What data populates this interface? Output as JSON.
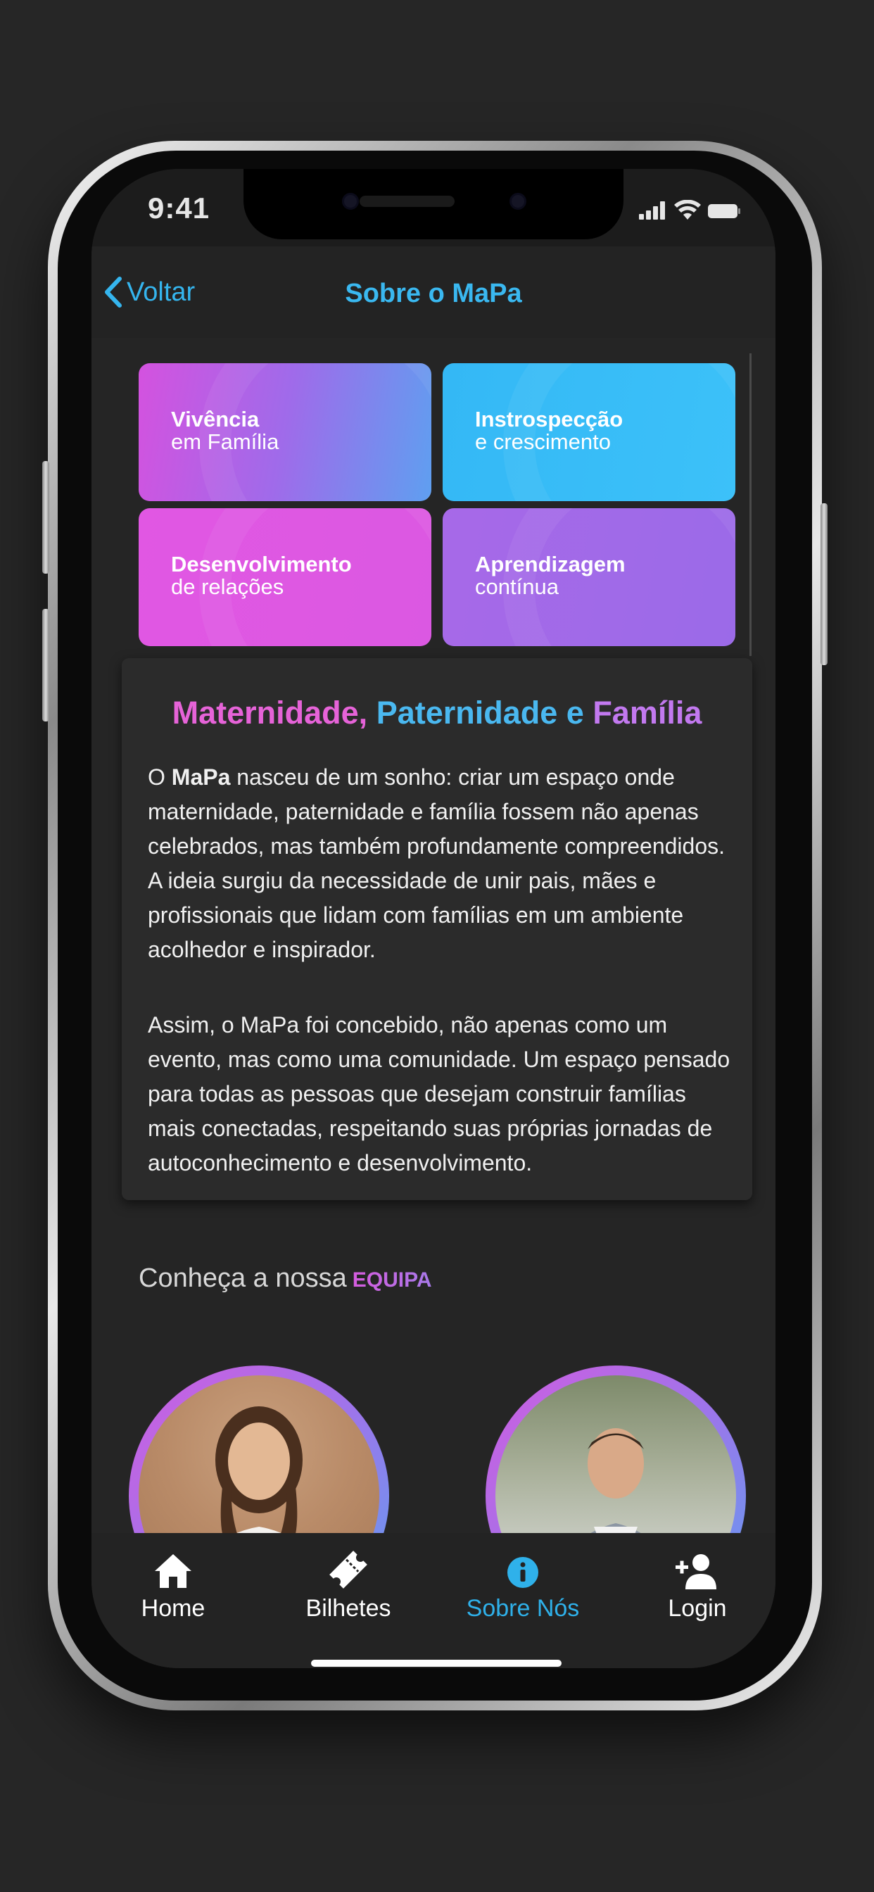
{
  "status_bar": {
    "time": "9:41"
  },
  "nav": {
    "back_label": "Voltar",
    "title": "Sobre o MaPa"
  },
  "tiles": [
    {
      "title": "Vivência",
      "subtitle": "em Família"
    },
    {
      "title": "Instrospecção",
      "subtitle": "e crescimento"
    },
    {
      "title": "Desenvolvimento",
      "subtitle": "de relações"
    },
    {
      "title": "Aprendizagem",
      "subtitle": "contínua"
    }
  ],
  "about": {
    "title_parts": [
      "Maternidade",
      ", ",
      "Paternidade e ",
      "Família"
    ],
    "p1_prefix": "O ",
    "p1_bold": "MaPa",
    "p1_rest": " nasceu de um sonho: criar um espaço onde maternidade, paternidade e família fossem não apenas celebrados, mas também profundamente compreendidos. A ideia surgiu da necessidade de unir pais, mães e profissionais que lidam com famílias em um ambiente acolhedor e inspirador.",
    "p2": "Assim, o MaPa foi concebido, não apenas como um evento, mas como uma comunidade. Um espaço pensado para todas as pessoas que desejam construir famílias mais conectadas, respeitando suas próprias jornadas de autoconhecimento e desenvolvimento."
  },
  "team": {
    "heading_prefix": "Conheça a nossa",
    "heading_highlight": "EQUIPA"
  },
  "tabbar": {
    "items": [
      {
        "label": "Home",
        "icon": "home-icon"
      },
      {
        "label": "Bilhetes",
        "icon": "ticket-icon"
      },
      {
        "label": "Sobre Nós",
        "icon": "info-icon"
      },
      {
        "label": "Login",
        "icon": "user-plus-icon"
      }
    ]
  },
  "colors": {
    "accent_blue": "#35b5ee",
    "accent_pink": "#e663d8",
    "accent_purple": "#c279ef",
    "background": "#252525"
  }
}
